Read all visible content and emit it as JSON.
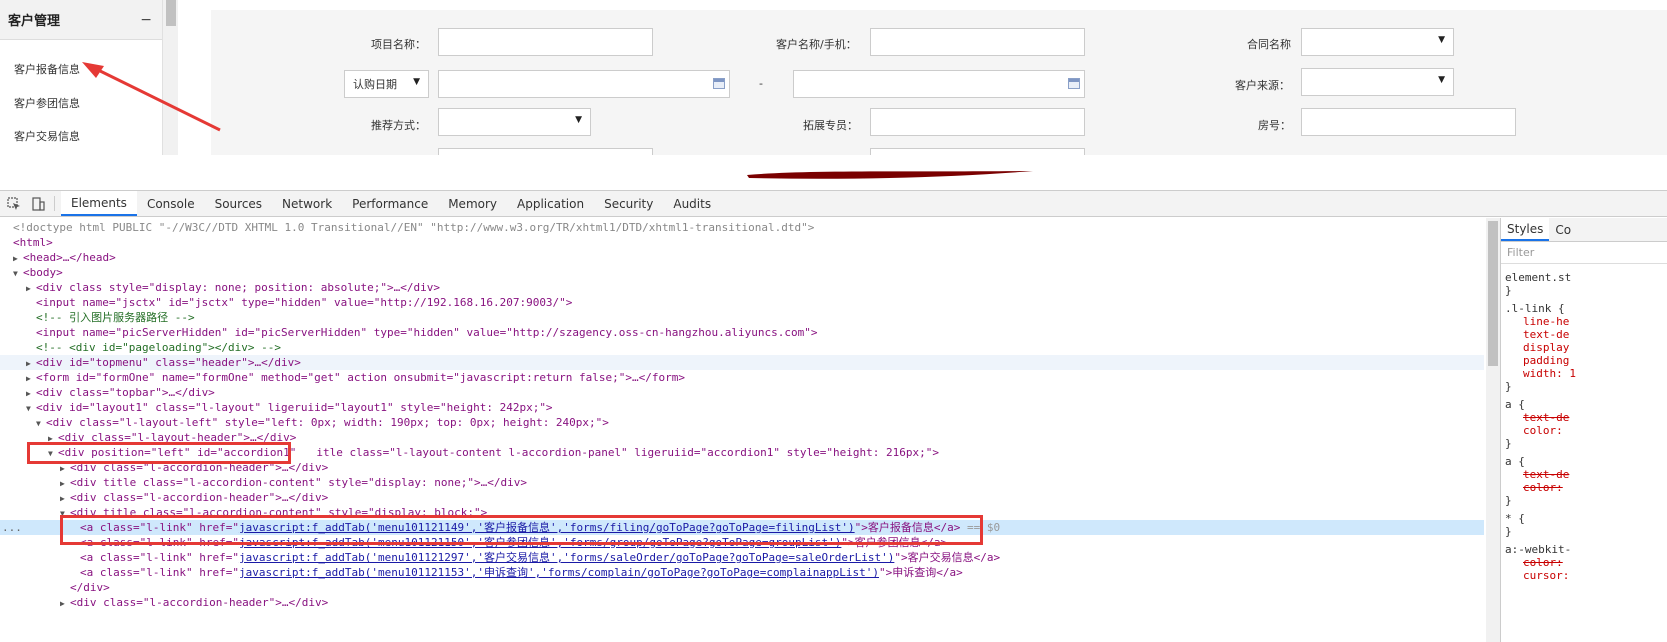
{
  "left_menu": {
    "title": "客户管理",
    "collapse_icon": "−",
    "items": [
      "客户报备信息",
      "客户参团信息",
      "客户交易信息"
    ]
  },
  "form": {
    "project_name": "项目名称：",
    "customer_name_phone": "客户名称/手机：",
    "contract_name": "合同名称",
    "purchase_date_select": "认购日期",
    "dash": "-",
    "customer_source": "客户来源：",
    "recommend_method": "推荐方式：",
    "expand_specialist": "拓展专员：",
    "room_no": "房号："
  },
  "devtools": {
    "tabs": [
      "Elements",
      "Console",
      "Sources",
      "Network",
      "Performance",
      "Memory",
      "Application",
      "Security",
      "Audits"
    ],
    "active_tab": "Elements",
    "lines": {
      "l0": "<!doctype html PUBLIC \"-//W3C//DTD XHTML 1.0 Transitional//EN\" \"http://www.w3.org/TR/xhtml1/DTD/xhtml1-transitional.dtd\">",
      "l1": "<html>",
      "l2": "<head>…</head>",
      "l3": "<body>",
      "l4a": "<div class style=\"display: none; position: absolute;\">…</div>",
      "l5a": "<input name=\"jsctx\" id=\"jsctx\" type=\"hidden\" value=\"http://192.168.16.207:9003/\">",
      "l6": "<!-- 引入图片服务器路径 -->",
      "l7": "<input name=\"picServerHidden\" id=\"picServerHidden\" type=\"hidden\" value=\"http://szagency.oss-cn-hangzhou.aliyuncs.com\">",
      "l8": "<!-- <div id=\"pageloading\"></div> -->",
      "l9": "<div id=\"topmenu\" class=\"header\">…</div>",
      "l10": "<form id=\"formOne\" name=\"formOne\" method=\"get\" action onsubmit=\"javascript:return false;\">…</form>",
      "l11": "<div class=\"topbar\">…</div>",
      "l12": "<div id=\"layout1\" class=\"l-layout\" ligeruiid=\"layout1\" style=\"height: 242px;\">",
      "l13": "<div class=\"l-layout-left\" style=\"left: 0px; width: 190px; top: 0px; height: 240px;\">",
      "l14": "<div class=\"l-layout-header\">…</div>",
      "l15a": "<div position=\"left\" id=\"accordion1\"",
      "l15b": "itle class=\"l-layout-content l-accordion-panel\" ligeruiid=\"accordion1\" style=\"height: 216px;\">",
      "l16": "<div class=\"l-accordion-header\">…</div>",
      "l17": "<div title class=\"l-accordion-content\" style=\"display: none;\">…</div>",
      "l18": "<div class=\"l-accordion-header\">…</div>",
      "l19": "<div title class=\"l-accordion-content\" style=\"display: block;\">",
      "l20_pre": "<a class=\"l-link\" href=\"",
      "l20_href": "javascript:f_addTab('menu101121149','客户报备信息','forms/filing/goToPage?goToPage=filingList')",
      "l20_text": "\">客户报备信息</a>",
      "l20_eq": " == $0",
      "l21_pre": "<a class=\"l-link\" href=\"",
      "l21_href": "javascript:f_addTab('menu101121150','客户参团信息','forms/group/goToPage?goToPage=groupList')",
      "l21_text": "\">客户参团信息</a>",
      "l22_pre": "<a class=\"l-link\" href=\"",
      "l22_href": "javascript:f_addTab('menu101121297','客户交易信息','forms/saleOrder/goToPage?goToPage=saleOrderList')",
      "l22_text": "\">客户交易信息</a>",
      "l23_pre": "<a class=\"l-link\" href=\"",
      "l23_href": "javascript:f_addTab('menu101121153','申诉查询','forms/complain/goToPage?goToPage=complainappList')",
      "l23_text": "\">申诉查询</a>",
      "l24": "</div>",
      "l25": "<div class=\"l-accordion-header\">…</div>",
      "ellipsis": "..."
    }
  },
  "styles_pane": {
    "tabs": [
      "Styles",
      "Co"
    ],
    "filter_placeholder": "Filter",
    "lines": {
      "s1": "element.st",
      "s2": "}",
      "s3": ".l-link {",
      "s4": "line-he",
      "s5": "text-de",
      "s6": "display",
      "s7": "padding",
      "s8": "width: 1",
      "s9": "}",
      "s10": "a {",
      "s11": "text-de",
      "s12": "color: ",
      "s13": "}",
      "s14": "a {",
      "s15": "text-de",
      "s16": "color: ",
      "s17": "}",
      "s18": "* {",
      "s19": "}",
      "s20": "a:-webkit-",
      "s21": "color: ",
      "s22": "cursor: "
    }
  }
}
